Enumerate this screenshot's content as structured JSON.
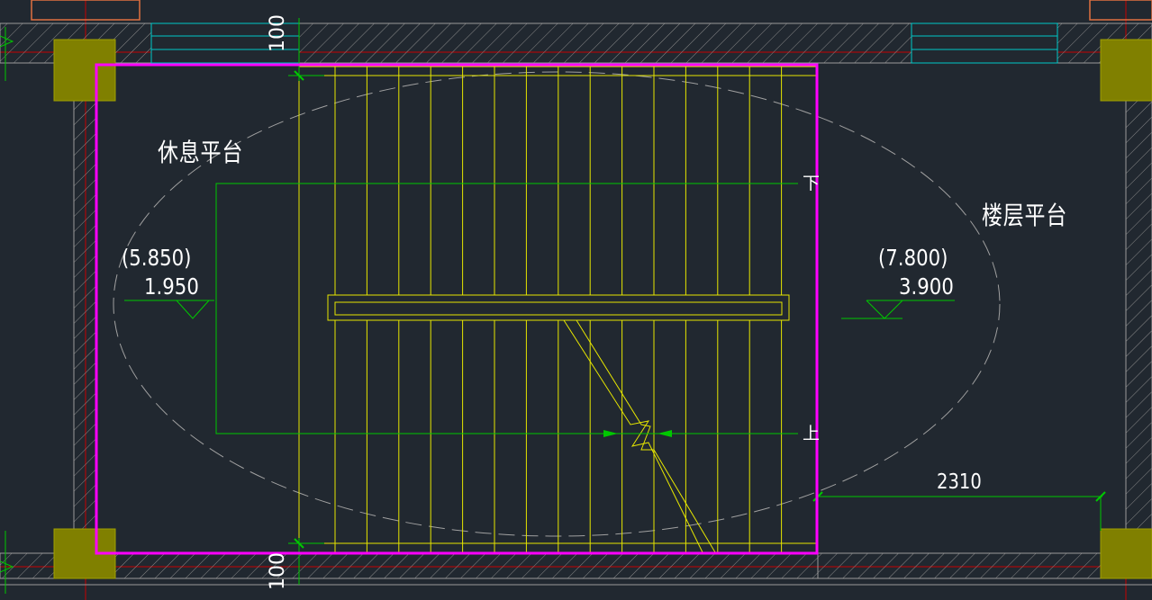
{
  "drawing": {
    "rest_platform_label": "休息平台",
    "floor_platform_label": "楼层平台",
    "rest_elevation_paren": "(5.850)",
    "rest_elevation": "1.950",
    "floor_elevation_paren": "(7.800)",
    "floor_elevation": "3.900",
    "dimension_2310": "2310",
    "dimension_100_top": "100",
    "dimension_100_bottom": "100",
    "arrow_down_label": "下",
    "arrow_up_label": "上"
  },
  "colors": {
    "background": "#212830",
    "stair_lines": "#e6e600",
    "selection_frame": "#ff00ff",
    "dimension_lines": "#00c800",
    "wall_hatch": "#9a9a9a",
    "column_fill": "#808000",
    "window_lines": "#00c8c8",
    "axis_lines": "#c80000",
    "text": "#ffffff"
  }
}
